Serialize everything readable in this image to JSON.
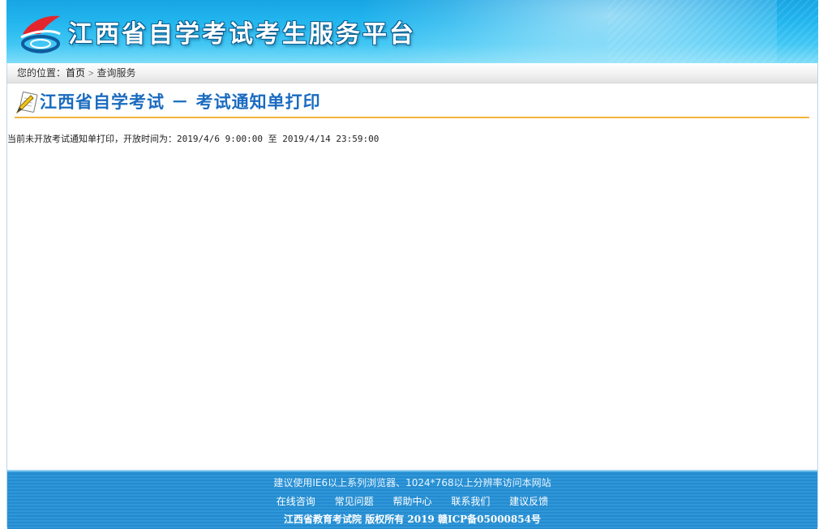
{
  "header": {
    "site_title": "江西省自学考试考生服务平台"
  },
  "breadcrumb": {
    "prefix": "您的位置：",
    "home": "首页",
    "current": "查询服务"
  },
  "main": {
    "page_title": "江西省自学考试 － 考试通知单打印",
    "notice": "当前未开放考试通知单打印，开放时间为：2019/4/6 9:00:00 至 2019/4/14 23:59:00"
  },
  "footer": {
    "tip": "建议使用IE6以上系列浏览器、1024*768以上分辨率访问本网站",
    "links": [
      "在线咨询",
      "常见问题",
      "帮助中心",
      "联系我们",
      "建议反馈"
    ],
    "copyright": "江西省教育考试院  版权所有  2019  赣ICP备05000854号"
  },
  "colors": {
    "header_blue": "#22b6ee",
    "title_blue": "#1a6bbf",
    "title_underline": "#f3b53c",
    "footer_blue": "#2f97d8"
  }
}
